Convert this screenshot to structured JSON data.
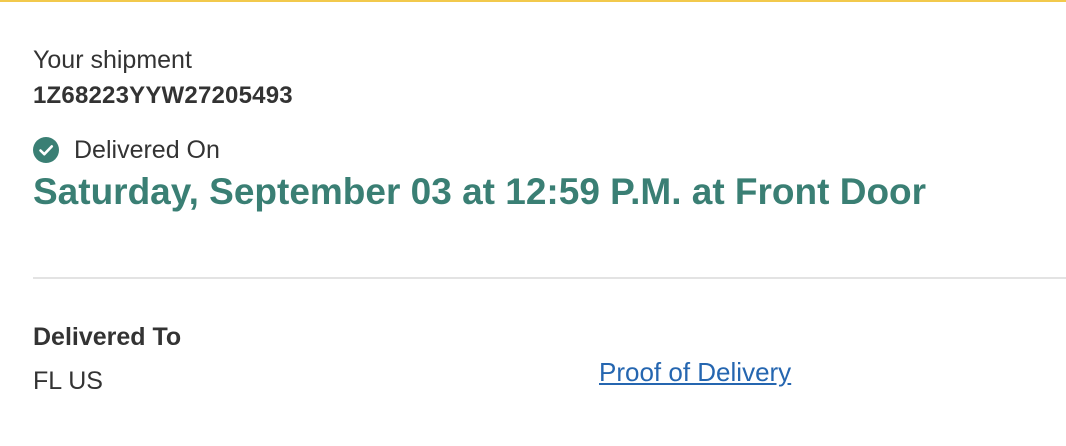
{
  "shipment": {
    "label": "Your shipment",
    "tracking_number": "1Z68223YYW27205493"
  },
  "status": {
    "icon": "check-circle-icon",
    "label": "Delivered On",
    "detail": "Saturday, September 03 at 12:59 P.M. at Front Door",
    "accent_color": "#3a7f74"
  },
  "delivered_to": {
    "heading": "Delivered To",
    "value": "FL US"
  },
  "links": {
    "proof_of_delivery": "Proof of Delivery",
    "link_color": "#2566b0"
  },
  "theme": {
    "top_border_color": "#f2c94c"
  }
}
